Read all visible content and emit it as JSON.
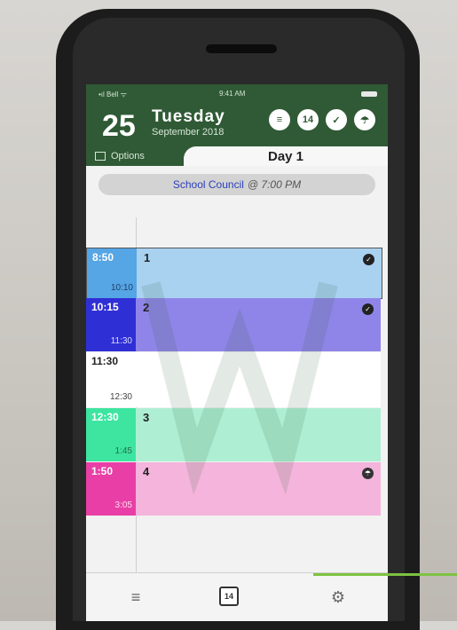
{
  "status_bar": {
    "carrier": "•ıl Bell ᯤ",
    "time": "9:41 AM"
  },
  "header": {
    "day_number": "25",
    "weekday": "Tuesday",
    "month_year": "September 2018",
    "icons": [
      "list-icon",
      "calendar-icon",
      "check-icon",
      "umbrella-icon"
    ],
    "calendar_icon_text": "14"
  },
  "options_label": "Options",
  "day_title": "Day 1",
  "event": {
    "title": "School Council",
    "time": "@ 7:00 PM"
  },
  "schedule": [
    {
      "start": "8:50",
      "end": "10:10",
      "label": "1",
      "color": "#56a5e4",
      "band": "#a9d2f1",
      "checked": true
    },
    {
      "start": "10:15",
      "end": "11:30",
      "label": "2",
      "color": "#2f2fd6",
      "band": "#8f85e8",
      "checked": true
    },
    {
      "start": "11:30",
      "end": "12:30",
      "label": "",
      "color": "#ffffff",
      "band": "#ffffff",
      "checked": false
    },
    {
      "start": "12:30",
      "end": "1:45",
      "label": "3",
      "color": "#3de5a0",
      "band": "#aeefd4",
      "checked": false
    },
    {
      "start": "1:50",
      "end": "3:05",
      "label": "4",
      "color": "#e83ea6",
      "band": "#f4b4dc",
      "checked": false
    }
  ],
  "tabbar": {
    "items": [
      "menu-icon",
      "calendar-icon",
      "settings-icon"
    ],
    "calendar_day": "14"
  },
  "colors": {
    "header_green": "#2f5a35",
    "accent_line": "#7dc242"
  }
}
